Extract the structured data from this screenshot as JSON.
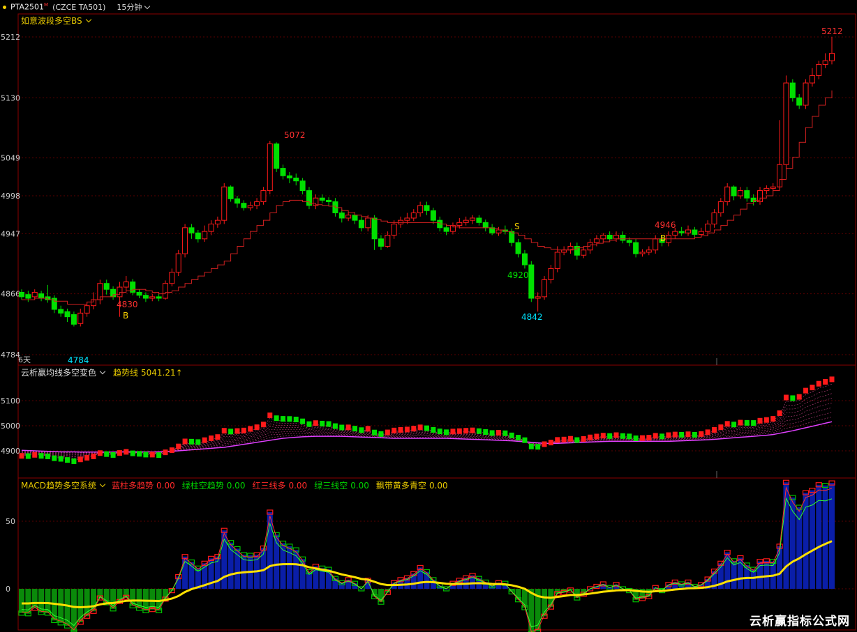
{
  "header": {
    "symbol": "PTA2501",
    "superscript": "M",
    "exchange": "(CZCE TA501)",
    "timeframe": "15分钟"
  },
  "panel1": {
    "indicator": "如意波段多空BS",
    "yticks": [
      "5212",
      "5130",
      "5049",
      "4998",
      "4947",
      "4866",
      "4784"
    ],
    "period_label": "6天",
    "annotations": {
      "high": "5212",
      "peak": "5072",
      "low_start": "4784",
      "b1_price": "4830",
      "b_label": "B",
      "s_label": "S",
      "mid_low": "4920",
      "bottom": "4842",
      "b2_price": "4946"
    }
  },
  "panel2": {
    "indicator": "云析赢均线多空变色",
    "trend_label": "趋势线",
    "trend_value": "5041.21↑",
    "yticks": [
      "5100",
      "5000",
      "4900"
    ]
  },
  "panel3": {
    "indicator": "MACD趋势多空系统",
    "items": [
      {
        "label": "蓝柱多趋势",
        "value": "0.00",
        "color": "red"
      },
      {
        "label": "绿柱空趋势",
        "value": "0.00",
        "color": "green"
      },
      {
        "label": "红三线多",
        "value": "0.00",
        "color": "red"
      },
      {
        "label": "绿三线空",
        "value": "0.00",
        "color": "green"
      },
      {
        "label": "飘带黄多青空",
        "value": "0.00",
        "color": "yellow"
      }
    ],
    "yticks": [
      "50",
      "0"
    ]
  },
  "chart_data": {
    "type": "candlestick",
    "price_candles": [
      [
        4868,
        4862,
        4872,
        4858
      ],
      [
        4865,
        4860,
        4870,
        4855
      ],
      [
        4862,
        4868,
        4872,
        4858
      ],
      [
        4866,
        4860,
        4870,
        4856
      ],
      [
        4862,
        4858,
        4878,
        4854
      ],
      [
        4860,
        4845,
        4864,
        4840
      ],
      [
        4845,
        4840,
        4850,
        4835
      ],
      [
        4842,
        4835,
        4846,
        4828
      ],
      [
        4838,
        4825,
        4842,
        4822
      ],
      [
        4826,
        4840,
        4846,
        4822
      ],
      [
        4840,
        4850,
        4855,
        4835
      ],
      [
        4850,
        4858,
        4868,
        4845
      ],
      [
        4858,
        4880,
        4885,
        4852
      ],
      [
        4880,
        4872,
        4885,
        4865
      ],
      [
        4872,
        4862,
        4876,
        4858
      ],
      [
        4862,
        4875,
        4882,
        4835
      ],
      [
        4875,
        4882,
        4890,
        4870
      ],
      [
        4882,
        4868,
        4886,
        4864
      ],
      [
        4868,
        4864,
        4872,
        4860
      ],
      [
        4864,
        4860,
        4868,
        4855
      ],
      [
        4860,
        4862,
        4866,
        4856
      ],
      [
        4862,
        4860,
        4866,
        4856
      ],
      [
        4860,
        4880,
        4884,
        4858
      ],
      [
        4880,
        4895,
        4900,
        4876
      ],
      [
        4895,
        4920,
        4925,
        4890
      ],
      [
        4920,
        4955,
        4960,
        4915
      ],
      [
        4955,
        4948,
        4960,
        4940
      ],
      [
        4948,
        4940,
        4952,
        4935
      ],
      [
        4940,
        4950,
        4958,
        4936
      ],
      [
        4950,
        4960,
        4965,
        4945
      ],
      [
        4960,
        4965,
        4970,
        4955
      ],
      [
        4965,
        5010,
        5015,
        4960
      ],
      [
        5010,
        4994,
        5012,
        4990
      ],
      [
        4994,
        4988,
        4998,
        4982
      ],
      [
        4988,
        4982,
        4992,
        4978
      ],
      [
        4982,
        4985,
        4990,
        4978
      ],
      [
        4985,
        4990,
        4995,
        4980
      ],
      [
        4990,
        5005,
        5010,
        4986
      ],
      [
        5005,
        5068,
        5072,
        5000
      ],
      [
        5068,
        5035,
        5070,
        5030
      ],
      [
        5035,
        5025,
        5040,
        5020
      ],
      [
        5025,
        5022,
        5030,
        5015
      ],
      [
        5022,
        5018,
        5028,
        5012
      ],
      [
        5018,
        5005,
        5022,
        5000
      ],
      [
        5005,
        4985,
        5010,
        4980
      ],
      [
        4985,
        4995,
        5000,
        4980
      ],
      [
        4995,
        4992,
        5000,
        4988
      ],
      [
        4992,
        4990,
        4996,
        4985
      ],
      [
        4990,
        4975,
        4995,
        4970
      ],
      [
        4975,
        4968,
        4980,
        4962
      ],
      [
        4968,
        4972,
        4976,
        4964
      ],
      [
        4972,
        4965,
        4976,
        4960
      ],
      [
        4965,
        4955,
        4970,
        4950
      ],
      [
        4955,
        4968,
        4972,
        4950
      ],
      [
        4968,
        4940,
        4972,
        4925
      ],
      [
        4940,
        4930,
        4945,
        4925
      ],
      [
        4930,
        4945,
        4950,
        4928
      ],
      [
        4945,
        4960,
        4965,
        4940
      ],
      [
        4960,
        4965,
        4970,
        4955
      ],
      [
        4965,
        4968,
        4975,
        4960
      ],
      [
        4968,
        4975,
        4980,
        4964
      ],
      [
        4975,
        4985,
        4990,
        4970
      ],
      [
        4985,
        4978,
        4990,
        4972
      ],
      [
        4978,
        4965,
        4982,
        4960
      ],
      [
        4965,
        4955,
        4970,
        4950
      ],
      [
        4955,
        4950,
        4960,
        4945
      ],
      [
        4950,
        4958,
        4962,
        4946
      ],
      [
        4958,
        4962,
        4968,
        4954
      ],
      [
        4962,
        4965,
        4970,
        4958
      ],
      [
        4965,
        4968,
        4972,
        4960
      ],
      [
        4968,
        4962,
        4972,
        4958
      ],
      [
        4962,
        4955,
        4966,
        4950
      ],
      [
        4955,
        4948,
        4960,
        4945
      ],
      [
        4948,
        4952,
        4956,
        4944
      ],
      [
        4952,
        4950,
        4958,
        4946
      ],
      [
        4950,
        4935,
        4954,
        4930
      ],
      [
        4935,
        4920,
        4940,
        4915
      ],
      [
        4920,
        4905,
        4925,
        4900
      ],
      [
        4905,
        4860,
        4910,
        4855
      ],
      [
        4860,
        4862,
        4868,
        4842
      ],
      [
        4862,
        4885,
        4890,
        4858
      ],
      [
        4885,
        4900,
        4905,
        4880
      ],
      [
        4900,
        4922,
        4930,
        4895
      ],
      [
        4922,
        4925,
        4930,
        4918
      ],
      [
        4925,
        4930,
        4935,
        4920
      ],
      [
        4930,
        4918,
        4935,
        4912
      ],
      [
        4918,
        4925,
        4930,
        4914
      ],
      [
        4925,
        4935,
        4940,
        4920
      ],
      [
        4935,
        4940,
        4945,
        4930
      ],
      [
        4940,
        4945,
        4948,
        4935
      ],
      [
        4945,
        4940,
        4950,
        4936
      ],
      [
        4940,
        4945,
        4950,
        4936
      ],
      [
        4945,
        4938,
        4950,
        4934
      ],
      [
        4938,
        4935,
        4942,
        4930
      ],
      [
        4935,
        4920,
        4940,
        4915
      ],
      [
        4920,
        4922,
        4926,
        4916
      ],
      [
        4922,
        4925,
        4930,
        4918
      ],
      [
        4925,
        4940,
        4945,
        4920
      ],
      [
        4940,
        4935,
        4944,
        4930
      ],
      [
        4935,
        4945,
        4950,
        4930
      ],
      [
        4945,
        4950,
        4955,
        4940
      ],
      [
        4950,
        4948,
        4956,
        4944
      ],
      [
        4948,
        4952,
        4958,
        4944
      ],
      [
        4952,
        4946,
        4956,
        4942
      ],
      [
        4946,
        4950,
        4955,
        4942
      ],
      [
        4950,
        4960,
        4965,
        4945
      ],
      [
        4960,
        4975,
        4980,
        4955
      ],
      [
        4975,
        4990,
        4995,
        4970
      ],
      [
        4990,
        5010,
        5015,
        4985
      ],
      [
        5010,
        4998,
        5012,
        4992
      ],
      [
        4998,
        5005,
        5010,
        4994
      ],
      [
        5005,
        4995,
        5010,
        4990
      ],
      [
        4995,
        4990,
        5000,
        4985
      ],
      [
        4990,
        5005,
        5010,
        4986
      ],
      [
        5005,
        5008,
        5012,
        5000
      ],
      [
        5008,
        5010,
        5015,
        5004
      ],
      [
        5010,
        5040,
        5100,
        5006
      ],
      [
        5040,
        5150,
        5160,
        5035
      ],
      [
        5150,
        5130,
        5155,
        5125
      ],
      [
        5130,
        5120,
        5135,
        5115
      ],
      [
        5120,
        5150,
        5155,
        5115
      ],
      [
        5150,
        5160,
        5170,
        5145
      ],
      [
        5160,
        5175,
        5180,
        5155
      ],
      [
        5175,
        5180,
        5190,
        5170
      ],
      [
        5180,
        5190,
        5212,
        5175
      ]
    ],
    "trend_line": [
      4858,
      4858,
      4860,
      4860,
      4858,
      4856,
      4856,
      4852,
      4852,
      4852,
      4855,
      4858,
      4862,
      4862,
      4865,
      4868,
      4870,
      4872,
      4872,
      4870,
      4868,
      4866,
      4868,
      4870,
      4875,
      4880,
      4885,
      4890,
      4895,
      4900,
      4905,
      4910,
      4920,
      4930,
      4940,
      4950,
      4958,
      4965,
      4975,
      4985,
      4990,
      4992,
      4992,
      4990,
      4988,
      4986,
      4985,
      4984,
      4982,
      4978,
      4975,
      4972,
      4970,
      4968,
      4966,
      4964,
      4962,
      4962,
      4962,
      4962,
      4962,
      4962,
      4962,
      4962,
      4960,
      4958,
      4956,
      4955,
      4955,
      4955,
      4955,
      4955,
      4954,
      4952,
      4950,
      4948,
      4945,
      4940,
      4935,
      4930,
      4928,
      4926,
      4925,
      4925,
      4926,
      4928,
      4930,
      4932,
      4934,
      4936,
      4938,
      4940,
      4940,
      4940,
      4940,
      4940,
      4940,
      4940,
      4940,
      4940,
      4940,
      4940,
      4940,
      4942,
      4944,
      4948,
      4952,
      4958,
      4965,
      4972,
      4980,
      4988,
      4992,
      4995,
      4998,
      5005,
      5020,
      5035,
      5050,
      5070,
      5090,
      5105,
      5120,
      5130,
      5140
    ],
    "ma_min": [
      4902,
      4901,
      4900,
      4899,
      4898,
      4897,
      4896,
      4896,
      4896,
      4895,
      4895,
      4895,
      4895,
      4895,
      4895,
      4896,
      4896,
      4896,
      4896,
      4896,
      4896,
      4896,
      4897,
      4898,
      4900,
      4902,
      4904,
      4906,
      4908,
      4910,
      4912,
      4914,
      4918,
      4922,
      4926,
      4930,
      4934,
      4938,
      4942,
      4946,
      4950,
      4952,
      4954,
      4956,
      4957,
      4958,
      4958,
      4958,
      4958,
      4958,
      4957,
      4956,
      4955,
      4954,
      4953,
      4952,
      4951,
      4950,
      4950,
      4950,
      4950,
      4950,
      4950,
      4950,
      4950,
      4950,
      4949,
      4948,
      4947,
      4946,
      4945,
      4944,
      4943,
      4942,
      4941,
      4940,
      4938,
      4936,
      4934,
      4932,
      4930,
      4930,
      4930,
      4931,
      4932,
      4933,
      4934,
      4935,
      4936,
      4937,
      4938,
      4938,
      4938,
      4938,
      4938,
      4938,
      4938,
      4938,
      4938,
      4938,
      4939,
      4940,
      4941,
      4942,
      4943,
      4944,
      4946,
      4948,
      4950,
      4952,
      4954,
      4956,
      4958,
      4960,
      4962,
      4965,
      4970,
      4975,
      4980,
      4986,
      4992,
      4998,
      5004,
      5010,
      5016
    ]
  }
}
